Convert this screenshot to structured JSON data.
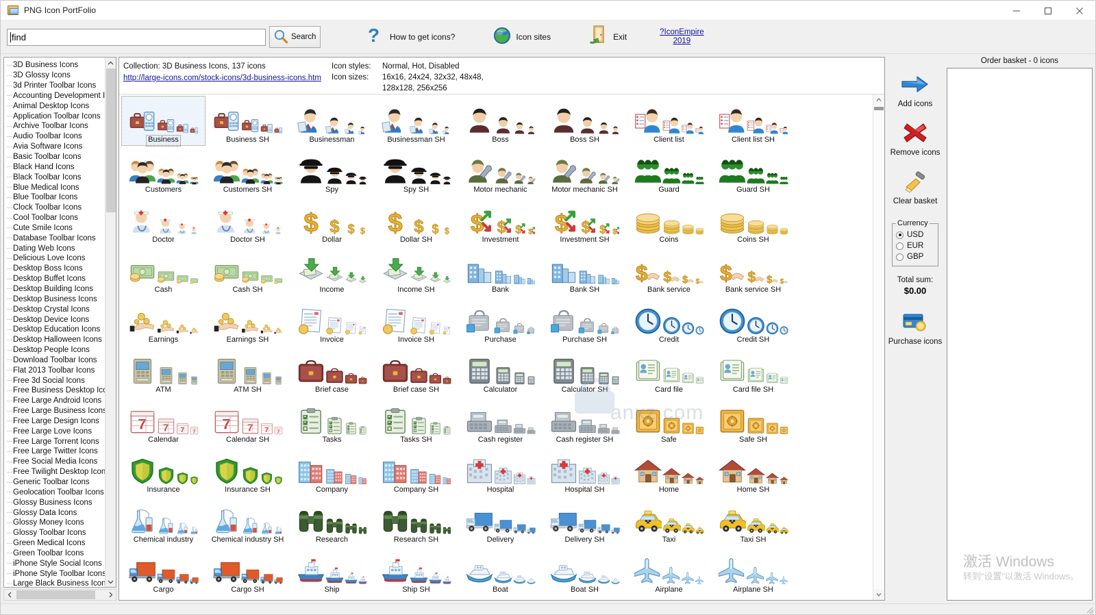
{
  "window": {
    "title": "PNG Icon PortFolio",
    "app_icon": "picture-icon",
    "minimize": "–",
    "maximize": "□",
    "close": "✕"
  },
  "search": {
    "value": "find",
    "placeholder": "",
    "button_label": "Search",
    "icon": "magnifier-icon"
  },
  "toolbar": {
    "items": [
      {
        "label": "How to get icons?",
        "icon": "question-mark-icon"
      },
      {
        "label": "Icon sites",
        "icon": "globe-icon"
      },
      {
        "label": "Exit",
        "icon": "exit-door-icon"
      }
    ],
    "brand_line1": "?IconEmpire",
    "brand_line2": "2019"
  },
  "sidebar": {
    "items": [
      "3D Business Icons",
      "3D Glossy Icons",
      "3d Printer Toolbar Icons",
      "Accounting Development Icon",
      "Animal Desktop Icons",
      "Application Toolbar Icons",
      "Archive Toolbar Icons",
      "Audio Toolbar Icons",
      "Avia Software Icons",
      "Basic Toolbar Icons",
      "Black Hand Icons",
      "Black Toolbar Icons",
      "Blue Medical Icons",
      "Blue Toolbar Icons",
      "Clock Toolbar Icons",
      "Cool Toolbar Icons",
      "Cute Smile Icons",
      "Database Toolbar Icons",
      "Dating Web Icons",
      "Delicious Love Icons",
      "Desktop Boss Icons",
      "Desktop Buffet Icons",
      "Desktop Building Icons",
      "Desktop Business Icons",
      "Desktop Crystal Icons",
      "Desktop Device Icons",
      "Desktop Education Icons",
      "Desktop Halloween Icons",
      "Desktop People Icons",
      "Download Toolbar Icons",
      "Flat 2013 Toolbar Icons",
      "Free 3d Social Icons",
      "Free Business Desktop Icons",
      "Free Large Android Icons",
      "Free Large Business Icons",
      "Free Large Design Icons",
      "Free Large Love Icons",
      "Free Large Torrent Icons",
      "Free Large Twitter Icons",
      "Free Social Media Icons",
      "Free Twilight Desktop Icons",
      "Generic Toolbar Icons",
      "Geolocation Toolbar Icons",
      "Glossy Business Icons",
      "Glossy Data Icons",
      "Glossy Money Icons",
      "Glossy Toolbar Icons",
      "Green Medical Icons",
      "Green Toolbar Icons",
      "iPhone Style Social Icons",
      "iPhone Style Toolbar Icons",
      "Large Black Business Icons"
    ],
    "selected": "3D Business Icons",
    "scroll_up_icon": "chevron-up-icon",
    "scroll_down_icon": "chevron-down-icon",
    "scroll_left_icon": "chevron-left-icon",
    "scroll_right_icon": "chevron-right-icon"
  },
  "collection": {
    "line": "Collection: 3D Business Icons, 137 icons",
    "url": "http://large-icons.com/stock-icons/3d-business-icons.htm",
    "styles_key": "Icon styles:",
    "styles_val": "Normal, Hot, Disabled",
    "sizes_key": "Icon sizes:",
    "sizes_val1": "16x16, 24x24, 32x32, 48x48,",
    "sizes_val2": "128x128, 256x256"
  },
  "grid": {
    "rows": [
      [
        {
          "label": "Business",
          "kind": "briefcase-phone",
          "selected": true
        },
        {
          "label": "Business SH",
          "kind": "briefcase-phone"
        },
        {
          "label": "Businessman",
          "kind": "businessman"
        },
        {
          "label": "Businessman SH",
          "kind": "businessman"
        },
        {
          "label": "Boss",
          "kind": "boss"
        },
        {
          "label": "Boss SH",
          "kind": "boss"
        },
        {
          "label": "Client list",
          "kind": "clientlist"
        },
        {
          "label": "Client list SH",
          "kind": "clientlist"
        }
      ],
      [
        {
          "label": "Customers",
          "kind": "customers"
        },
        {
          "label": "Customers SH",
          "kind": "customers"
        },
        {
          "label": "Spy",
          "kind": "spy"
        },
        {
          "label": "Spy SH",
          "kind": "spy"
        },
        {
          "label": "Motor mechanic",
          "kind": "mechanic"
        },
        {
          "label": "Motor mechanic SH",
          "kind": "mechanic"
        },
        {
          "label": "Guard",
          "kind": "guard"
        },
        {
          "label": "Guard SH",
          "kind": "guard"
        }
      ],
      [
        {
          "label": "Doctor",
          "kind": "doctor"
        },
        {
          "label": "Doctor SH",
          "kind": "doctor"
        },
        {
          "label": "Dollar",
          "kind": "dollar"
        },
        {
          "label": "Dollar SH",
          "kind": "dollar"
        },
        {
          "label": "Investment",
          "kind": "investment"
        },
        {
          "label": "Investment SH",
          "kind": "investment"
        },
        {
          "label": "Coins",
          "kind": "coins"
        },
        {
          "label": "Coins SH",
          "kind": "coins"
        }
      ],
      [
        {
          "label": "Cash",
          "kind": "cash"
        },
        {
          "label": "Cash SH",
          "kind": "cash"
        },
        {
          "label": "Income",
          "kind": "income"
        },
        {
          "label": "Income SH",
          "kind": "income"
        },
        {
          "label": "Bank",
          "kind": "bank"
        },
        {
          "label": "Bank SH",
          "kind": "bank"
        },
        {
          "label": "Bank service",
          "kind": "bankservice"
        },
        {
          "label": "Bank service SH",
          "kind": "bankservice"
        }
      ],
      [
        {
          "label": "Earnings",
          "kind": "earnings"
        },
        {
          "label": "Earnings SH",
          "kind": "earnings"
        },
        {
          "label": "Invoice",
          "kind": "invoice"
        },
        {
          "label": "Invoice SH",
          "kind": "invoice"
        },
        {
          "label": "Purchase",
          "kind": "purchase"
        },
        {
          "label": "Purchase SH",
          "kind": "purchase"
        },
        {
          "label": "Credit",
          "kind": "credit"
        },
        {
          "label": "Credit SH",
          "kind": "credit"
        }
      ],
      [
        {
          "label": "ATM",
          "kind": "atm"
        },
        {
          "label": "ATM  SH",
          "kind": "atm"
        },
        {
          "label": "Brief case",
          "kind": "briefcase"
        },
        {
          "label": "Brief case SH",
          "kind": "briefcase"
        },
        {
          "label": "Calculator",
          "kind": "calculator"
        },
        {
          "label": "Calculator SH",
          "kind": "calculator"
        },
        {
          "label": "Card file",
          "kind": "cardfile"
        },
        {
          "label": "Card file SH",
          "kind": "cardfile"
        }
      ],
      [
        {
          "label": "Calendar",
          "kind": "calendar"
        },
        {
          "label": "Calendar SH",
          "kind": "calendar"
        },
        {
          "label": "Tasks",
          "kind": "tasks"
        },
        {
          "label": "Tasks SH",
          "kind": "tasks"
        },
        {
          "label": "Cash register",
          "kind": "register"
        },
        {
          "label": "Cash register SH",
          "kind": "register"
        },
        {
          "label": "Safe",
          "kind": "safe"
        },
        {
          "label": "Safe SH",
          "kind": "safe"
        }
      ],
      [
        {
          "label": "Insurance",
          "kind": "shield"
        },
        {
          "label": "Insurance SH",
          "kind": "shield"
        },
        {
          "label": "Company",
          "kind": "company"
        },
        {
          "label": "Company SH",
          "kind": "company"
        },
        {
          "label": "Hospital",
          "kind": "hospital"
        },
        {
          "label": "Hospital SH",
          "kind": "hospital"
        },
        {
          "label": "Home",
          "kind": "home"
        },
        {
          "label": "Home SH",
          "kind": "home"
        }
      ],
      [
        {
          "label": "Chemical industry",
          "kind": "chemistry"
        },
        {
          "label": "Chemical industry SH",
          "kind": "chemistry"
        },
        {
          "label": "Research",
          "kind": "binoculars"
        },
        {
          "label": "Research SH",
          "kind": "binoculars"
        },
        {
          "label": "Delivery",
          "kind": "truck"
        },
        {
          "label": "Delivery SH",
          "kind": "truck"
        },
        {
          "label": "Taxi",
          "kind": "taxi"
        },
        {
          "label": "Taxi SH",
          "kind": "taxi"
        }
      ],
      [
        {
          "label": "Cargo",
          "kind": "cargo"
        },
        {
          "label": "Cargo SH",
          "kind": "cargo"
        },
        {
          "label": "Ship",
          "kind": "ship"
        },
        {
          "label": "Ship SH",
          "kind": "ship"
        },
        {
          "label": "Boat",
          "kind": "boat"
        },
        {
          "label": "Boat SH",
          "kind": "boat"
        },
        {
          "label": "Airplane",
          "kind": "airplane"
        },
        {
          "label": "Airplane SH",
          "kind": "airplane"
        }
      ]
    ]
  },
  "basket": {
    "title": "Order basket - 0 icons",
    "actions": [
      {
        "label": "Add icons",
        "icon": "blue-arrow-right-icon"
      },
      {
        "label": "Remove icons",
        "icon": "red-x-icon"
      },
      {
        "label": "Clear basket",
        "icon": "broom-icon"
      }
    ],
    "currency": {
      "legend": "Currency",
      "options": [
        "USD",
        "EUR",
        "GBP"
      ],
      "selected": "USD"
    },
    "total_label": "Total sum:",
    "total_value": "$0.00",
    "purchase": {
      "label": "Purchase icons",
      "icon": "credit-card-icon"
    }
  },
  "watermarks": {
    "site": "anxz.com",
    "activation_title": "激活 Windows",
    "activation_subtitle": "转到“设置”以激活 Windows。"
  },
  "colors": {
    "accent_blue": "#2a6fb5",
    "link": "#1111a8",
    "panel_bg": "#f0f0f0",
    "selection": "#eef4fb"
  }
}
